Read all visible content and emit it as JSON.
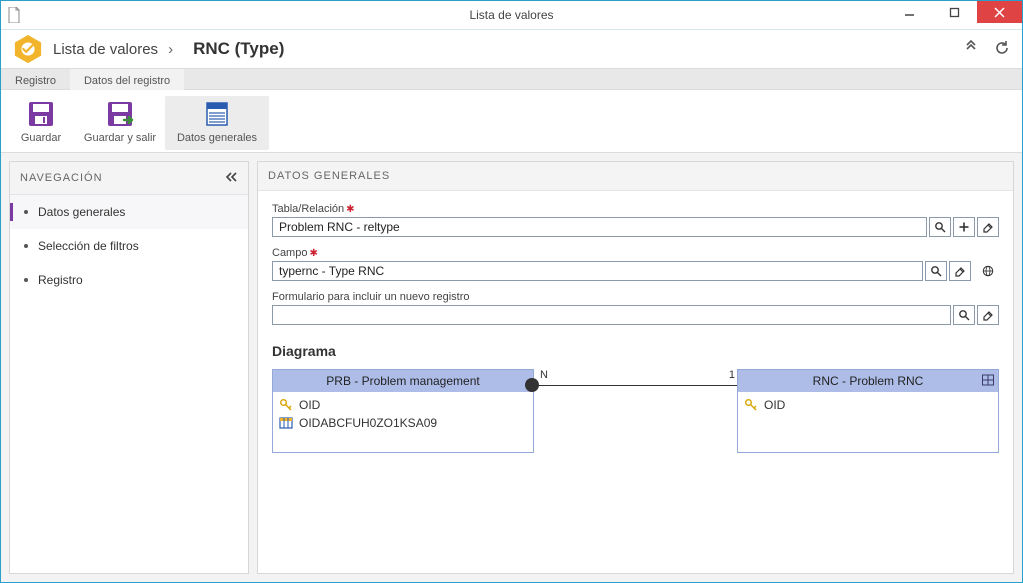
{
  "window": {
    "title": "Lista de valores"
  },
  "breadcrumb": {
    "parent": "Lista de valores",
    "separator": "›",
    "current": "RNC (Type)"
  },
  "ribbon": {
    "tab_registro": "Registro",
    "tab_datos": "Datos del registro",
    "action_save": "Guardar",
    "action_save_exit": "Guardar y salir",
    "action_general": "Datos generales"
  },
  "sidebar": {
    "header": "NAVEGACIÓN",
    "items": [
      {
        "label": "Datos generales"
      },
      {
        "label": "Selección de filtros"
      },
      {
        "label": "Registro"
      }
    ]
  },
  "main": {
    "header": "DATOS GENERALES",
    "table_label": "Tabla/Relación",
    "table_value": "Problem RNC - reltype",
    "field_label": "Campo",
    "field_value": "typernc - Type RNC",
    "form_label": "Formulario para incluir un nuevo registro",
    "form_value": "",
    "diagram_title": "Diagrama",
    "entity1": {
      "title": "PRB - Problem management",
      "row1": "OID",
      "row2": "OIDABCFUH0ZO1KSA09"
    },
    "link": {
      "left": "N",
      "right": "1"
    },
    "entity2": {
      "title": "RNC - Problem RNC",
      "row1": "OID"
    }
  }
}
